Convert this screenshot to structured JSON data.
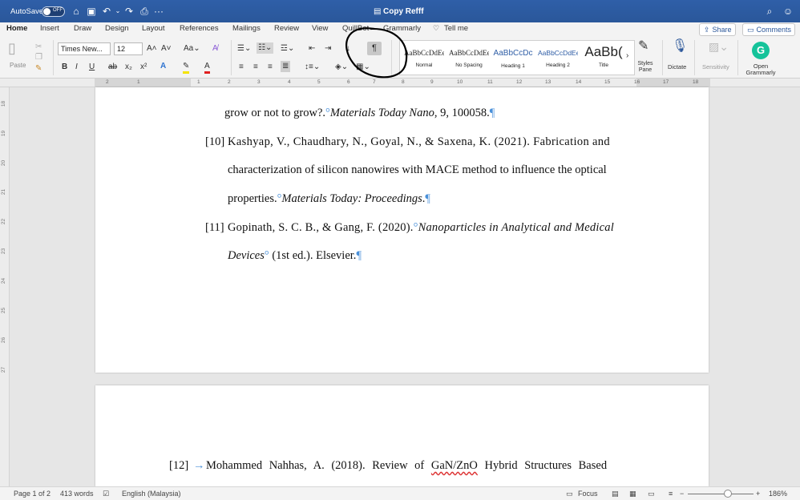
{
  "titlebar": {
    "autosave_label": "AutoSave",
    "autosave_state": "OFF",
    "doc_title": "Copy Refff"
  },
  "tabs": [
    {
      "label": "Home"
    },
    {
      "label": "Insert"
    },
    {
      "label": "Draw"
    },
    {
      "label": "Design"
    },
    {
      "label": "Layout"
    },
    {
      "label": "References"
    },
    {
      "label": "Mailings"
    },
    {
      "label": "Review"
    },
    {
      "label": "View"
    },
    {
      "label": "QuillBot"
    },
    {
      "label": "Grammarly"
    },
    {
      "label": "Tell me"
    }
  ],
  "share": {
    "share_label": "Share",
    "comments_label": "Comments"
  },
  "ribbon": {
    "paste_label": "Paste",
    "font_name": "Times New...",
    "font_size": "12",
    "pilcrow": "¶",
    "styles": [
      {
        "preview": "AaBbCcDdEe",
        "name": "Normal"
      },
      {
        "preview": "AaBbCcDdEe",
        "name": "No Spacing"
      },
      {
        "preview": "AaBbCcDc",
        "name": "Heading 1"
      },
      {
        "preview": "AaBbCcDdEe",
        "name": "Heading 2"
      },
      {
        "preview": "AaBb(",
        "name": "Title"
      }
    ],
    "styles_pane_label": "Styles Pane",
    "dictate_label": "Dictate",
    "sensitivity_label": "Sensitivity",
    "grammarly_label": "Open Grammarly"
  },
  "ruler": {
    "numbers": [
      "2",
      "1",
      "1",
      "2",
      "3",
      "4",
      "5",
      "6",
      "7",
      "8",
      "9",
      "10",
      "11",
      "12",
      "13",
      "14",
      "15",
      "16",
      "17",
      "18"
    ]
  },
  "vruler": {
    "numbers": [
      "18",
      "19",
      "20",
      "21",
      "22",
      "23",
      "24",
      "25",
      "26",
      "27"
    ]
  },
  "document": {
    "line1_a": "grow or not to grow?.",
    "line1_b": "Materials Today Nano",
    "line1_c": ", 9, 100058.",
    "ref10_num": "[10]",
    "ref10_l1": "Kashyap, V., Chaudhary, N., Goyal, N., & Saxena, K. (2021). Fabrication and",
    "ref10_l2": "characterization of silicon nanowires with MACE method to influence the optical",
    "ref10_l3a": "properties.",
    "ref10_l3b": "Materials Today: Proceedings",
    "ref10_l3c": ".",
    "ref11_num": "[11]",
    "ref11_l1a": "Gopinath, S. C. B., & Gang, F. (2020).",
    "ref11_l1b": "Nanoparticles in Analytical and Medical",
    "ref11_l2a": "Devices",
    "ref11_l2b": " (1st ed.). Elsevier.",
    "ref12_num": "[12]",
    "ref12_arrow": "→",
    "ref12_l1a": "Mohammed Nahhas, A. (2018). Review of ",
    "ref12_l1b": "GaN/ZnO",
    "ref12_l1c": " Hybrid Structures Based"
  },
  "status": {
    "page": "Page 1 of 2",
    "words": "413 words",
    "language": "English (Malaysia)",
    "focus": "Focus",
    "zoom": "186%"
  },
  "colors": {
    "accent": "#2b579a",
    "annotation_circle": "#000000"
  }
}
